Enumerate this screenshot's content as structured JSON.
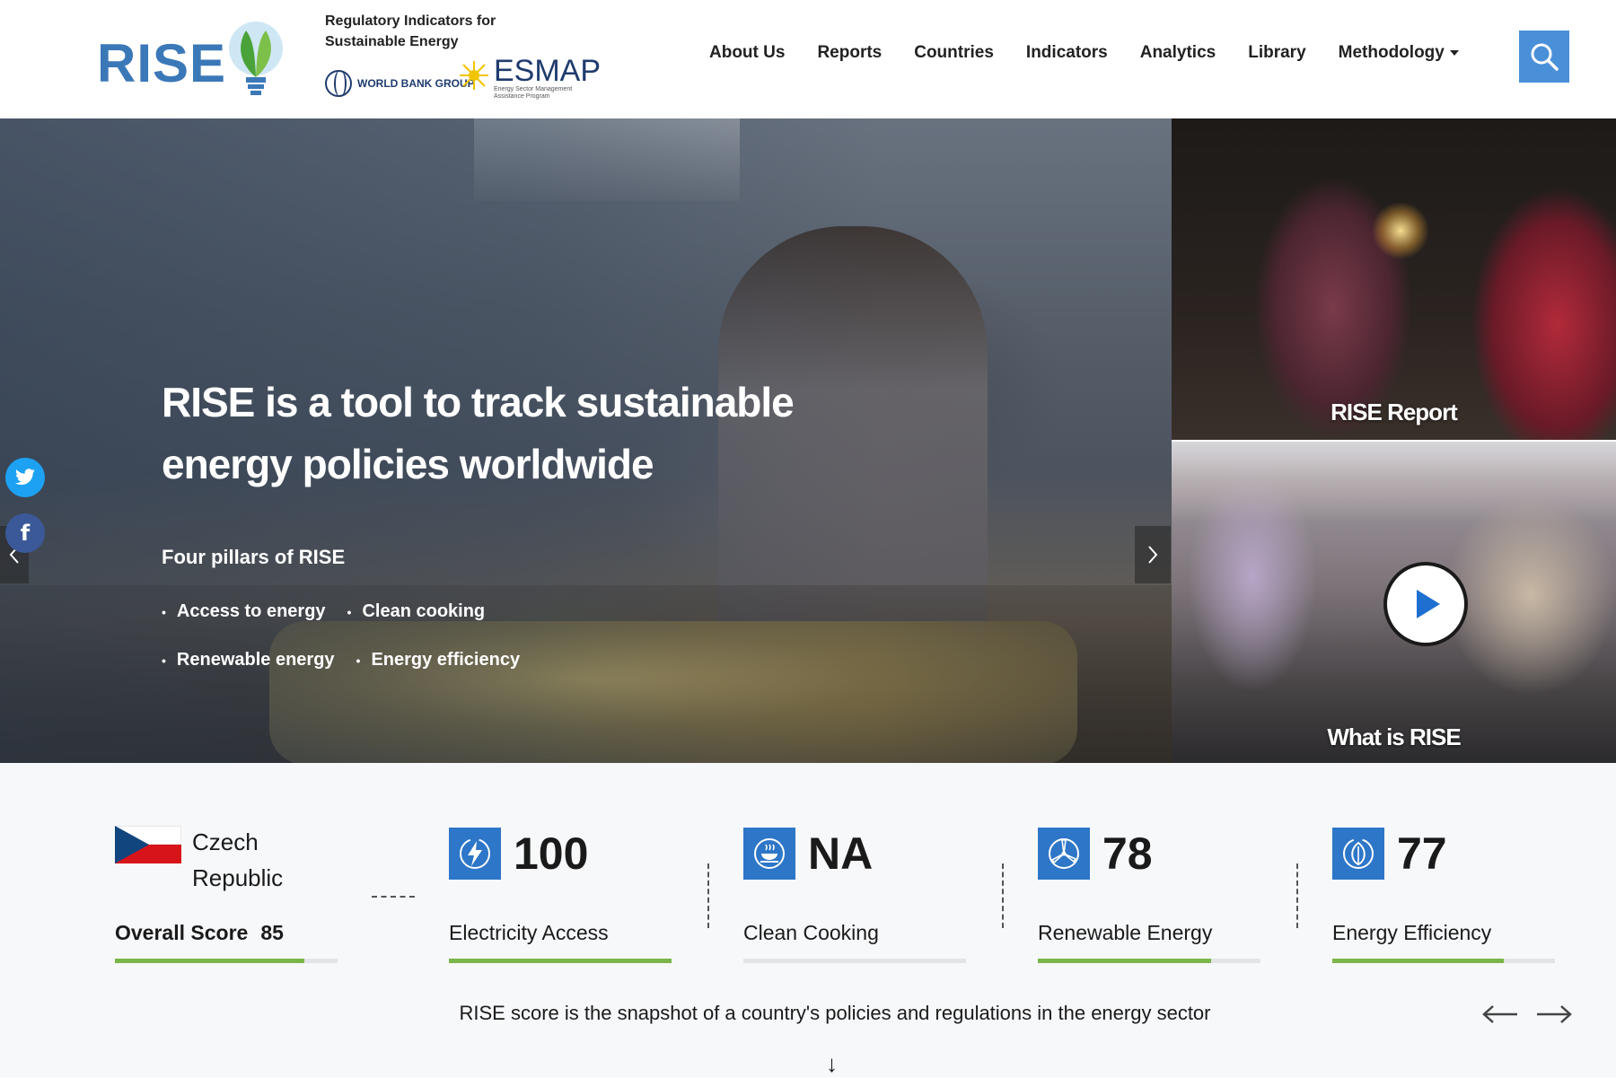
{
  "header": {
    "logo_text": "RISE",
    "tagline_1": "Regulatory Indicators for",
    "tagline_2": "Sustainable Energy",
    "wbg_text": "WORLD BANK GROUP",
    "esmap_name": "ESMAP",
    "esmap_sub": "Energy Sector Management Assistance Program",
    "nav": [
      "About Us",
      "Reports",
      "Countries",
      "Indicators",
      "Analytics",
      "Library",
      "Methodology"
    ],
    "search_icon": "search-icon"
  },
  "hero": {
    "title": "RISE is a tool to track sustainable energy policies worldwide",
    "pillars_title": "Four pillars of RISE",
    "pillars": [
      "Access to energy",
      "Clean cooking",
      "Renewable energy",
      "Energy efficiency"
    ]
  },
  "panels": {
    "report_label": "RISE Report",
    "video_label": "What is RISE"
  },
  "social": {
    "twitter_icon": "twitter-icon",
    "facebook_icon": "facebook-icon"
  },
  "scores": {
    "country_line1": "Czech",
    "country_line2": "Republic",
    "overall_label": "Overall Score",
    "overall_value": "85",
    "overall_fraction": 0.85,
    "metrics": [
      {
        "label": "Electricity Access",
        "value": "100",
        "fraction": 1.0,
        "icon": "electricity-icon"
      },
      {
        "label": "Clean Cooking",
        "value": "NA",
        "fraction": 0,
        "icon": "cooking-icon"
      },
      {
        "label": "Renewable Energy",
        "value": "78",
        "fraction": 0.78,
        "icon": "wind-turbine-icon"
      },
      {
        "label": "Energy Efficiency",
        "value": "77",
        "fraction": 0.77,
        "icon": "leaf-icon"
      }
    ],
    "caption": "RISE score is the snapshot of a country's policies and regulations in the energy sector"
  },
  "colors": {
    "accent": "#2d76c8",
    "bar_fill": "#7ab648",
    "search_bg": "#4a90d9"
  }
}
